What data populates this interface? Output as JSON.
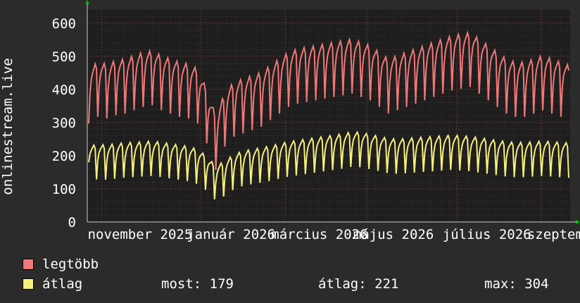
{
  "chart_data": {
    "type": "line",
    "ylabel": "onlinestream.live",
    "ylim": [
      0,
      640
    ],
    "yticks": [
      0,
      100,
      200,
      300,
      400,
      500,
      600
    ],
    "xtick_labels": [
      "november 2025",
      "január 2026",
      "március 2026",
      "május 2026",
      "július 2026",
      "szeptember"
    ],
    "grid": true,
    "x_start": "2025-09-26",
    "x_end": "2026-09-30",
    "series": [
      {
        "name": "legtöbb",
        "color": "#f07878",
        "summary": "daily peak viewers, weekly oscillation roughly between 290 and 520, dip near new year to about 230",
        "values_weekly": [
          440,
          460,
          455,
          465,
          470,
          480,
          490,
          495,
          480,
          470,
          460,
          455,
          440,
          380,
          300,
          370,
          400,
          410,
          420,
          430,
          450,
          470,
          490,
          500,
          505,
          510,
          515,
          520,
          525,
          530,
          520,
          510,
          490,
          470,
          480,
          490,
          500,
          510,
          520,
          530,
          540,
          545,
          550,
          530,
          510,
          490,
          470,
          460,
          460,
          470,
          480,
          470,
          460,
          450,
          440
        ]
      },
      {
        "name": "átlag",
        "color": "#f5f07a",
        "summary": "average viewers, oscillating roughly between 150 and 260, peak about 304",
        "values_weekly": [
          215,
          220,
          218,
          222,
          225,
          226,
          228,
          230,
          226,
          222,
          218,
          214,
          205,
          185,
          155,
          170,
          190,
          200,
          205,
          210,
          215,
          222,
          228,
          232,
          236,
          240,
          244,
          248,
          252,
          258,
          256,
          250,
          244,
          238,
          236,
          238,
          240,
          242,
          244,
          246,
          248,
          246,
          244,
          240,
          236,
          232,
          228,
          226,
          226,
          228,
          230,
          228,
          226,
          224,
          222
        ]
      }
    ]
  },
  "legend": {
    "max_label": "legtöbb",
    "avg_label": "átlag",
    "max_color": "#f07878",
    "avg_color": "#f5f07a"
  },
  "stats": {
    "now": "most: 179",
    "avg": "átlag: 221",
    "max": "max: 304"
  }
}
